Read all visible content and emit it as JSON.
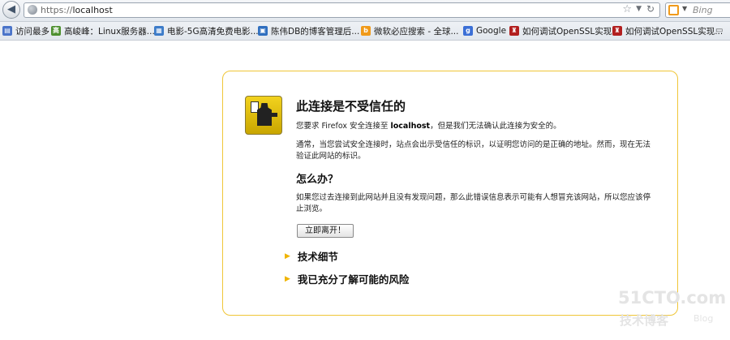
{
  "navbar": {
    "url_scheme": "https://",
    "url_host": "localhost",
    "search_placeholder": "Bing",
    "back_icon": "back-arrow-icon",
    "star_icon": "bookmark-star-icon",
    "reload_icon": "reload-icon"
  },
  "bookmarks": {
    "items": [
      {
        "label": "访问最多",
        "icon_color": "#4a74c9",
        "icon_char": "▤"
      },
      {
        "label": "高峻峰：Linux服务器...",
        "icon_color": "#4d8f2e",
        "icon_char": "高"
      },
      {
        "label": "电影-5G高清免费电影...",
        "icon_color": "#3d7cc9",
        "icon_char": "▦"
      },
      {
        "label": "陈伟DB的博客管理后...",
        "icon_color": "#2f6fbf",
        "icon_char": "▣"
      },
      {
        "label": "微软必应搜索 - 全球...",
        "icon_color": "#f09a1a",
        "icon_char": "b"
      },
      {
        "label": "Google",
        "icon_color": "#3b6fd6",
        "icon_char": "g"
      },
      {
        "label": "如何调试OpenSSL实现...",
        "icon_color": "#b21f1f",
        "icon_char": "♜"
      },
      {
        "label": "如何调试OpenSSL实现...",
        "icon_color": "#b21f1f",
        "icon_char": "♜"
      }
    ]
  },
  "panel": {
    "title": "此连接是不受信任的",
    "p1_prefix": "您要求 Firefox 安全连接至 ",
    "p1_host": "localhost",
    "p1_suffix": "，但是我们无法确认此连接为安全的。",
    "p2": "通常，当您尝试安全连接时，站点会出示受信任的标识，以证明您访问的是正确的地址。然而，现在无法验证此网站的标识。",
    "subhead": "怎么办？",
    "p3": "如果您过去连接到此网站并且没有发现问题，那么此错误信息表示可能有人想冒充该网站，所以您应该停止浏览。",
    "leave_button": "立即离开！",
    "expander1": "技术细节",
    "expander2": "我已充分了解可能的风险"
  },
  "watermark": {
    "line1": "51CTO.com",
    "line2": "技术博客",
    "line3": "Blog"
  }
}
